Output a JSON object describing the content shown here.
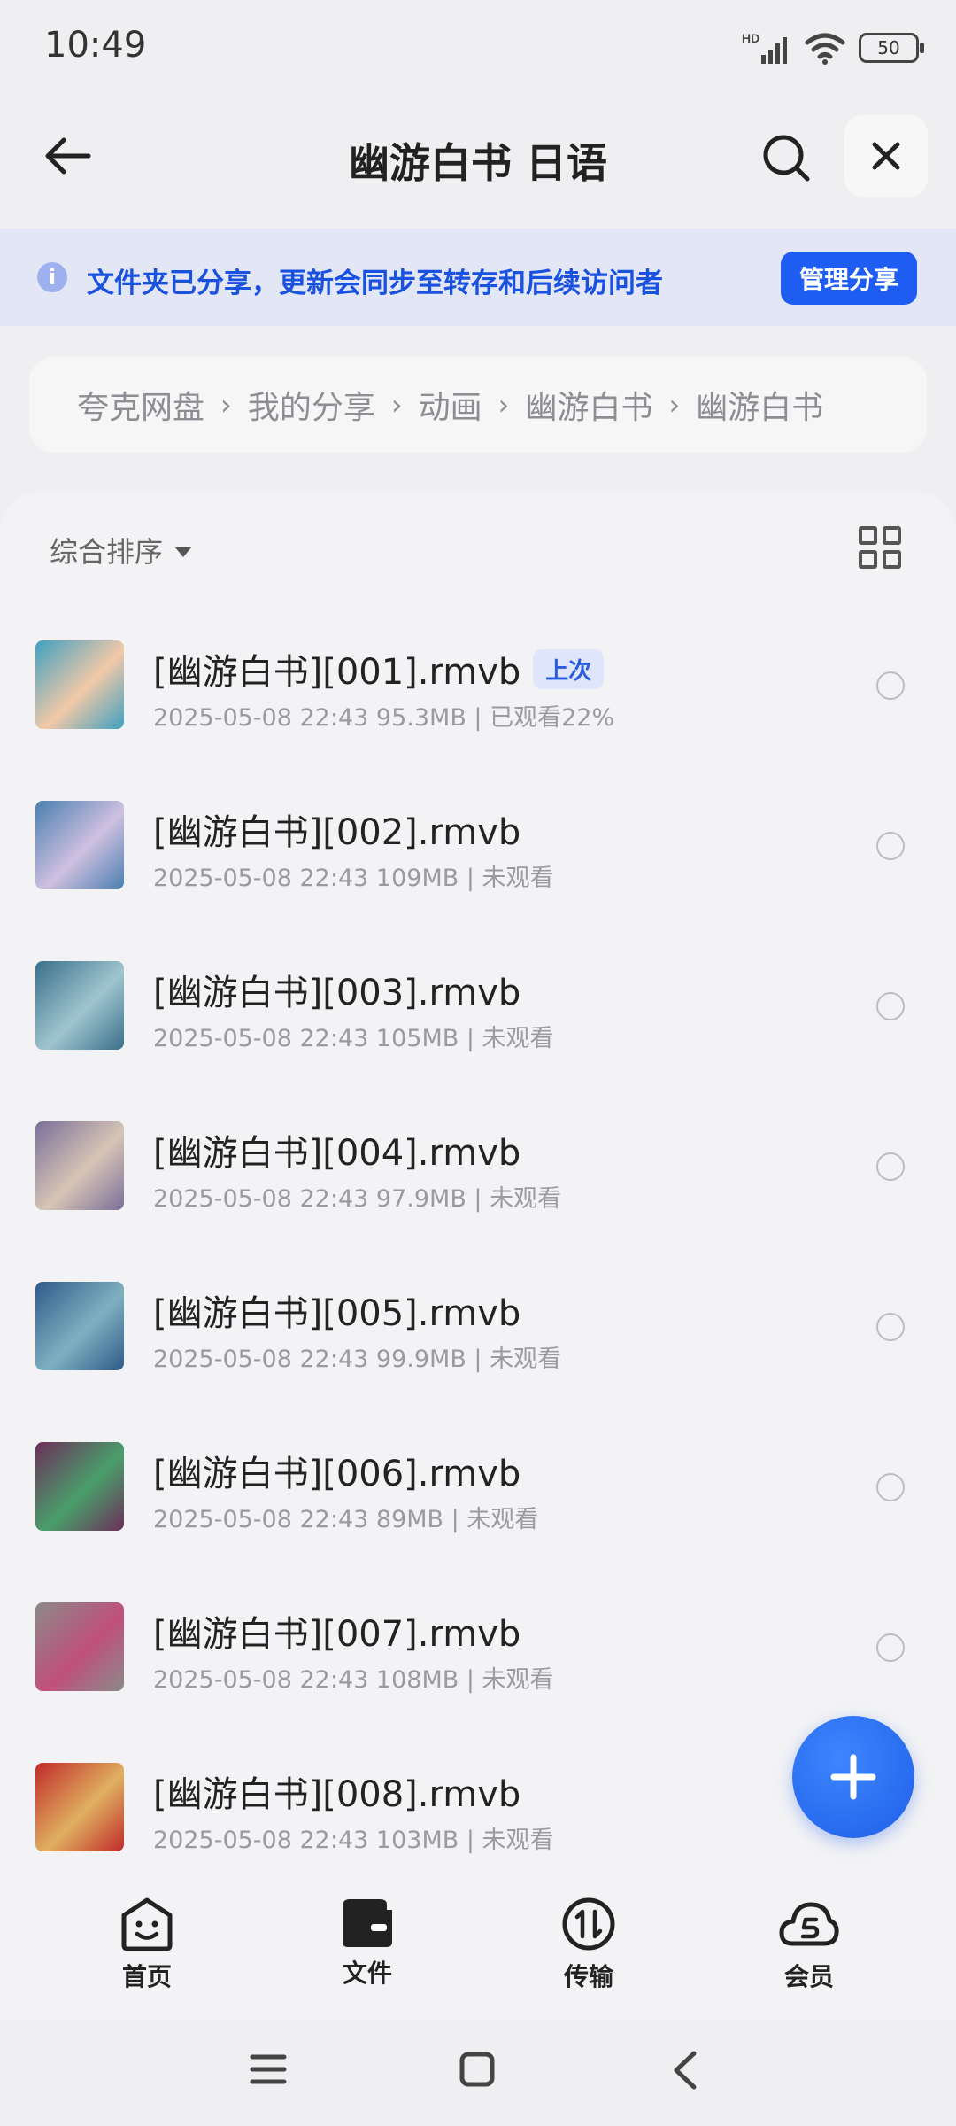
{
  "status": {
    "time": "10:49",
    "battery": "50",
    "network": "HD"
  },
  "header": {
    "title": "幽游白书 日语"
  },
  "banner": {
    "text": "文件夹已分享，更新会同步至转存和后续访问者",
    "button": "管理分享"
  },
  "breadcrumb": {
    "items": [
      "夸克网盘",
      "我的分享",
      "动画",
      "幽游白书",
      "幽游白书"
    ]
  },
  "toolbar": {
    "sort_label": "综合排序"
  },
  "files": [
    {
      "name": "[幽游白书][001].rmvb",
      "badge": "上次",
      "date": "2025-05-08 22:43",
      "size": "95.3MB",
      "status": "已观看22%"
    },
    {
      "name": "[幽游白书][002].rmvb",
      "date": "2025-05-08 22:43",
      "size": "109MB",
      "status": "未观看"
    },
    {
      "name": "[幽游白书][003].rmvb",
      "date": "2025-05-08 22:43",
      "size": "105MB",
      "status": "未观看"
    },
    {
      "name": "[幽游白书][004].rmvb",
      "date": "2025-05-08 22:43",
      "size": "97.9MB",
      "status": "未观看"
    },
    {
      "name": "[幽游白书][005].rmvb",
      "date": "2025-05-08 22:43",
      "size": "99.9MB",
      "status": "未观看"
    },
    {
      "name": "[幽游白书][006].rmvb",
      "date": "2025-05-08 22:43",
      "size": "89MB",
      "status": "未观看"
    },
    {
      "name": "[幽游白书][007].rmvb",
      "date": "2025-05-08 22:43",
      "size": "108MB",
      "status": "未观看"
    },
    {
      "name": "[幽游白书][008].rmvb",
      "date": "2025-05-08 22:43",
      "size": "103MB",
      "status": "未观看"
    }
  ],
  "thumb_colors": [
    [
      "#3fa0c0",
      "#f2c9a8"
    ],
    [
      "#4a7fb0",
      "#cfc0e0"
    ],
    [
      "#3a6f8a",
      "#9fc5cf"
    ],
    [
      "#7b6f9a",
      "#d7c5b5"
    ],
    [
      "#2f5a8a",
      "#7fb0c0"
    ],
    [
      "#6b2f5a",
      "#4a9f6a"
    ],
    [
      "#8a8a8a",
      "#c0507a"
    ],
    [
      "#c02a2a",
      "#e0b060"
    ]
  ],
  "nav": {
    "home": "首页",
    "files": "文件",
    "transfer": "传输",
    "vip": "会员"
  }
}
